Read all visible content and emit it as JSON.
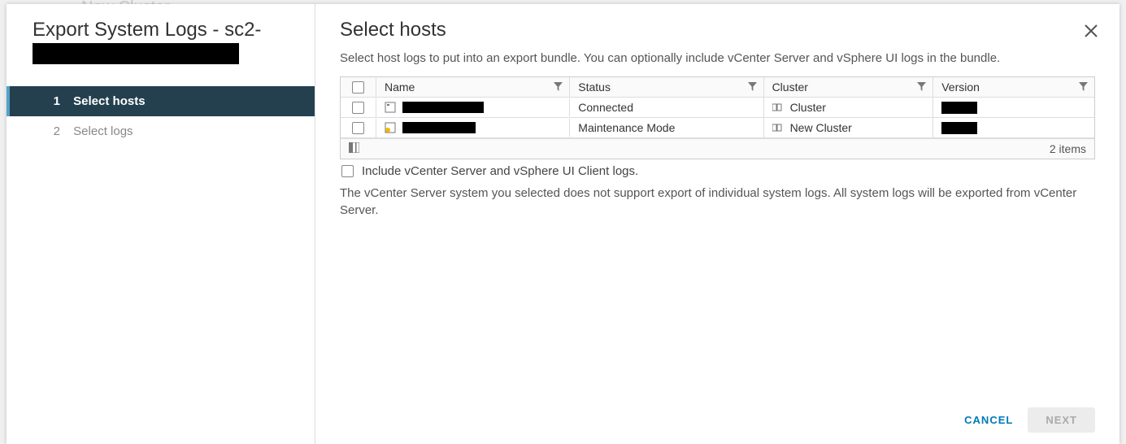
{
  "background": {
    "crumb": "New Cluster"
  },
  "wizard": {
    "title_prefix": "Export System Logs - sc2-"
  },
  "steps": [
    {
      "num": "1",
      "label": "Select hosts",
      "active": true
    },
    {
      "num": "2",
      "label": "Select logs",
      "active": false
    }
  ],
  "page": {
    "title": "Select hosts",
    "description": "Select host logs to put into an export bundle. You can optionally include vCenter Server and vSphere UI logs in the bundle."
  },
  "table": {
    "headers": {
      "name": "Name",
      "status": "Status",
      "cluster": "Cluster",
      "version": "Version"
    },
    "rows": [
      {
        "status": "Connected",
        "cluster": "Cluster",
        "maintenance": false
      },
      {
        "status": "Maintenance Mode",
        "cluster": "New Cluster",
        "maintenance": true
      }
    ],
    "footer_count": "2 items"
  },
  "include": {
    "label": "Include vCenter Server and vSphere UI Client logs."
  },
  "note": "The vCenter Server system you selected does not support export of individual system logs. All system logs will be exported from vCenter Server.",
  "buttons": {
    "cancel": "CANCEL",
    "next": "NEXT"
  }
}
